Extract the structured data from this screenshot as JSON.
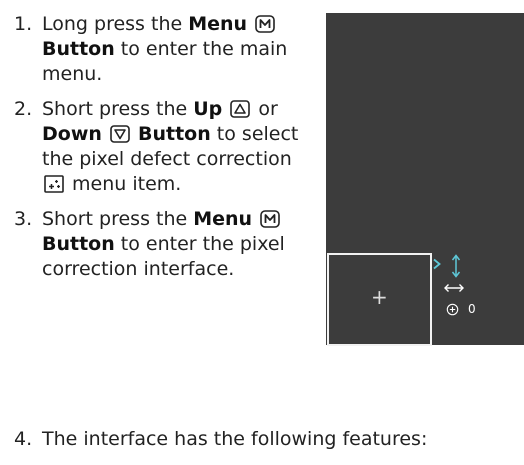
{
  "steps": [
    {
      "num": "1.",
      "t1": "Long press the ",
      "b1": "Menu",
      "b2": "Button",
      "t2": " to enter the main menu."
    },
    {
      "num": "2.",
      "t1": "Short press the ",
      "up": "Up",
      "t_or": " or ",
      "down": "Down",
      "b_button": "Button",
      "t2": " to select the pixel defect correction ",
      "t3": " menu item."
    },
    {
      "num": "3.",
      "t1": "Short press the ",
      "b1": "Menu",
      "b2": "Button",
      "t2": " to enter the pixel correction interface."
    },
    {
      "num": "4.",
      "t1": "The interface has the following features:"
    }
  ],
  "screen": {
    "x_coord": "0",
    "colors": {
      "background": "#3c3c3c",
      "frame": "#f2f2f2",
      "arrow_accent": "#5ec8d8"
    }
  },
  "icons": {
    "menu_button": "menu-m-button-icon",
    "up_button": "triangle-up-button-icon",
    "down_button": "triangle-down-button-icon",
    "pixel_correction": "pixel-defect-correction-icon"
  }
}
